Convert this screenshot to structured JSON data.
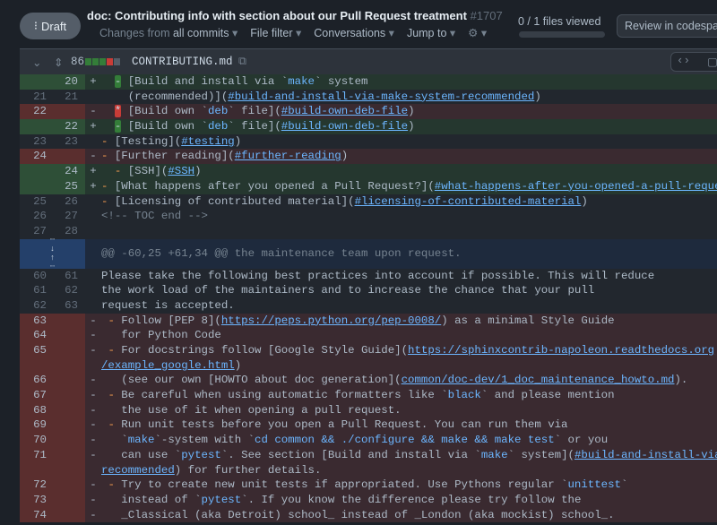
{
  "header": {
    "draft_label": "Draft",
    "title": "doc: Contributing info with section about our Pull Request treatment",
    "pr_number": "#1707",
    "nav": [
      {
        "prefix": "Changes from ",
        "bold": "all commits",
        "caret": "▾"
      },
      {
        "prefix": "",
        "bold": "File filter",
        "caret": "▾"
      },
      {
        "prefix": "",
        "bold": "Conversations",
        "caret": "▾"
      },
      {
        "prefix": "",
        "bold": "Jump to",
        "caret": "▾"
      }
    ],
    "settings_icon": "gear-icon",
    "files_viewed": "0 / 1 files viewed",
    "files_viewed_progress": 0,
    "review_button": "Review in codespace"
  },
  "file": {
    "changes": "86",
    "diffstat": [
      "#347d39",
      "#347d39",
      "#347d39",
      "#c93c37",
      "#545d68"
    ],
    "name": "CONTRIBUTING.md"
  },
  "hunk_header": "@@ -60,25 +61,34 @@ the maintenance team upon request.",
  "rows_top": [
    {
      "o": "",
      "n": "20",
      "t": "add",
      "s": "+",
      "c": [
        [
          "t",
          "  "
        ],
        [
          "bg",
          "-"
        ],
        [
          "t",
          " [Build and install via `"
        ],
        [
          "k",
          "make"
        ],
        [
          "t",
          "` system"
        ]
      ]
    },
    {
      "o": "21",
      "n": "21",
      "t": "ctx",
      "s": "",
      "c": [
        [
          "t",
          "    (recommended)]("
        ],
        [
          "l",
          "#build-and-install-via-make-system-recommended"
        ],
        [
          "t",
          ")"
        ]
      ]
    },
    {
      "o": "22",
      "n": "",
      "t": "del",
      "s": "-",
      "c": [
        [
          "t",
          "  "
        ],
        [
          "br",
          "*"
        ],
        [
          "t",
          " [Build own `"
        ],
        [
          "k",
          "deb"
        ],
        [
          "t",
          "` file]("
        ],
        [
          "l",
          "#build-own-deb-file"
        ],
        [
          "t",
          ")"
        ]
      ]
    },
    {
      "o": "",
      "n": "22",
      "t": "add",
      "s": "+",
      "c": [
        [
          "t",
          "  "
        ],
        [
          "bg",
          "-"
        ],
        [
          "t",
          " [Build own `"
        ],
        [
          "k",
          "deb"
        ],
        [
          "t",
          "` file]("
        ],
        [
          "l",
          "#build-own-deb-file"
        ],
        [
          "t",
          ")"
        ]
      ]
    },
    {
      "o": "23",
      "n": "23",
      "t": "ctx",
      "s": "",
      "c": [
        [
          "b",
          "-"
        ],
        [
          "t",
          " [Testing]("
        ],
        [
          "l",
          "#testing"
        ],
        [
          "t",
          ")"
        ]
      ]
    },
    {
      "o": "24",
      "n": "",
      "t": "del",
      "s": "-",
      "c": [
        [
          "b",
          "-"
        ],
        [
          "t",
          " [Further reading]("
        ],
        [
          "l",
          "#further-reading"
        ],
        [
          "t",
          ")"
        ]
      ]
    },
    {
      "o": "",
      "n": "24",
      "t": "add",
      "s": "+",
      "c": [
        [
          "t",
          "  "
        ],
        [
          "b",
          "-"
        ],
        [
          "t",
          " [SSH]("
        ],
        [
          "l",
          "#SSH"
        ],
        [
          "t",
          ")"
        ]
      ]
    },
    {
      "o": "",
      "n": "25",
      "t": "add",
      "s": "+",
      "c": [
        [
          "b",
          "-"
        ],
        [
          "t",
          " [What happens after you opened a Pull Request?]("
        ],
        [
          "l",
          "#what-happens-after-you-opened-a-pull-request"
        ],
        [
          "t",
          ")"
        ]
      ]
    },
    {
      "o": "25",
      "n": "26",
      "t": "ctx",
      "s": "",
      "c": [
        [
          "b",
          "-"
        ],
        [
          "t",
          " [Licensing of contributed material]("
        ],
        [
          "l",
          "#licensing-of-contributed-material"
        ],
        [
          "t",
          ")"
        ]
      ]
    },
    {
      "o": "26",
      "n": "27",
      "t": "ctx",
      "s": "",
      "c": [
        [
          "m",
          "<!-- TOC end -->"
        ]
      ]
    },
    {
      "o": "27",
      "n": "28",
      "t": "ctx",
      "s": "",
      "c": []
    }
  ],
  "rows_bottom": [
    {
      "o": "60",
      "n": "61",
      "t": "ctx",
      "s": "",
      "c": [
        [
          "t",
          "Please take the following best practices into account if possible. This will reduce"
        ]
      ]
    },
    {
      "o": "61",
      "n": "62",
      "t": "ctx",
      "s": "",
      "c": [
        [
          "t",
          "the work load of the maintainers and to increase the chance that your pull"
        ]
      ]
    },
    {
      "o": "62",
      "n": "63",
      "t": "ctx",
      "s": "",
      "c": [
        [
          "t",
          "request is accepted."
        ]
      ]
    },
    {
      "o": "63",
      "n": "",
      "t": "del",
      "s": "-",
      "c": [
        [
          "t",
          " "
        ],
        [
          "b",
          "-"
        ],
        [
          "t",
          " Follow [PEP 8]("
        ],
        [
          "l",
          "https://peps.python.org/pep-0008/"
        ],
        [
          "t",
          ") as a minimal Style Guide"
        ]
      ]
    },
    {
      "o": "64",
      "n": "",
      "t": "del",
      "s": "-",
      "c": [
        [
          "t",
          "   for Python Code"
        ]
      ]
    },
    {
      "o": "65",
      "n": "",
      "t": "del",
      "s": "-",
      "c": [
        [
          "t",
          " "
        ],
        [
          "b",
          "-"
        ],
        [
          "t",
          " For docstrings follow [Google Style Guide]("
        ],
        [
          "l",
          "https://sphinxcontrib-napoleon.readthedocs.org"
        ]
      ]
    },
    {
      "o": "",
      "n": "",
      "t": "del",
      "s": "",
      "c": [
        [
          "l",
          "/example_google.html"
        ],
        [
          "t",
          ")"
        ]
      ]
    },
    {
      "o": "66",
      "n": "",
      "t": "del",
      "s": "-",
      "c": [
        [
          "t",
          "   (see our own [HOWTO about doc generation]("
        ],
        [
          "l",
          "common/doc-dev/1_doc_maintenance_howto.md"
        ],
        [
          "t",
          ")."
        ]
      ]
    },
    {
      "o": "67",
      "n": "",
      "t": "del",
      "s": "-",
      "c": [
        [
          "t",
          " "
        ],
        [
          "b",
          "-"
        ],
        [
          "t",
          " Be careful when using automatic formatters like `"
        ],
        [
          "k",
          "black"
        ],
        [
          "t",
          "` and please mention"
        ]
      ]
    },
    {
      "o": "68",
      "n": "",
      "t": "del",
      "s": "-",
      "c": [
        [
          "t",
          "   the use of it when opening a pull request."
        ]
      ]
    },
    {
      "o": "69",
      "n": "",
      "t": "del",
      "s": "-",
      "c": [
        [
          "t",
          " "
        ],
        [
          "b",
          "-"
        ],
        [
          "t",
          " Run unit tests before you open a Pull Request. You can run them via"
        ]
      ]
    },
    {
      "o": "70",
      "n": "",
      "t": "del",
      "s": "-",
      "c": [
        [
          "t",
          "   `"
        ],
        [
          "k",
          "make"
        ],
        [
          "t",
          "`-system with `"
        ],
        [
          "k",
          "cd common && ./configure && make && make test"
        ],
        [
          "t",
          "` or you"
        ]
      ]
    },
    {
      "o": "71",
      "n": "",
      "t": "del",
      "s": "-",
      "c": [
        [
          "t",
          "   can use `"
        ],
        [
          "k",
          "pytest"
        ],
        [
          "t",
          "`. See section [Build and install via `"
        ],
        [
          "k",
          "make"
        ],
        [
          "t",
          "` system]("
        ],
        [
          "l",
          "#build-and-install-via-make-system-"
        ]
      ]
    },
    {
      "o": "",
      "n": "",
      "t": "del",
      "s": "",
      "c": [
        [
          "l",
          "recommended"
        ],
        [
          "t",
          ") for further details."
        ]
      ]
    },
    {
      "o": "72",
      "n": "",
      "t": "del",
      "s": "-",
      "c": [
        [
          "t",
          " "
        ],
        [
          "b",
          "-"
        ],
        [
          "t",
          " Try to create new unit tests if appropriated. Use Pythons regular `"
        ],
        [
          "k",
          "unittest"
        ],
        [
          "t",
          "`"
        ]
      ]
    },
    {
      "o": "73",
      "n": "",
      "t": "del",
      "s": "-",
      "c": [
        [
          "t",
          "   instead of `"
        ],
        [
          "k",
          "pytest"
        ],
        [
          "t",
          "`. If you know the difference please try follow the"
        ]
      ]
    },
    {
      "o": "74",
      "n": "",
      "t": "del",
      "s": "-",
      "c": [
        [
          "t",
          "   _Classical (aka Detroit) school_ instead of _London (aka mockist) school_."
        ]
      ]
    }
  ]
}
